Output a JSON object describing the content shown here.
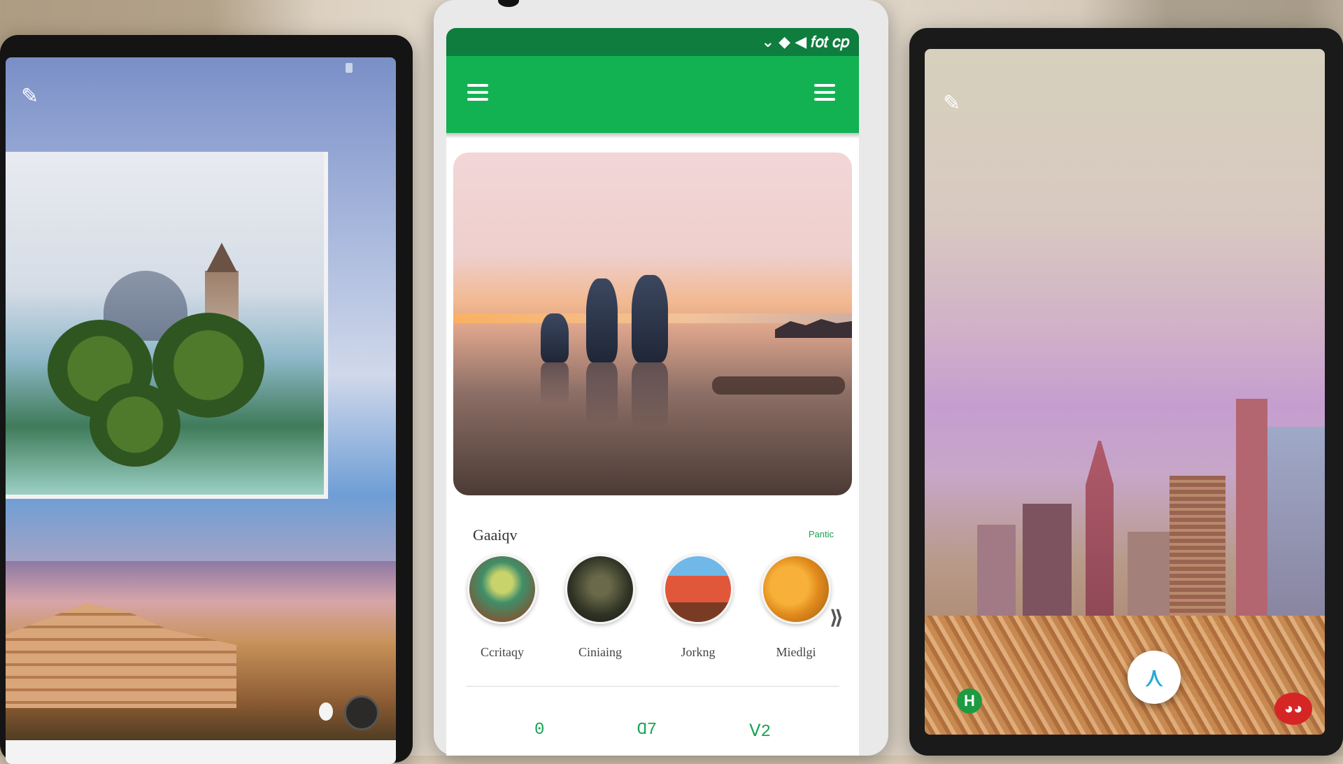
{
  "status_bar": {
    "text": "⌄ ◆ ◀ 𝑓𝑜𝑡 𝑐𝑝"
  },
  "gallery": {
    "title": "Gaaiqv",
    "link": "Pantic",
    "categories": [
      {
        "label": "Ccritaqy"
      },
      {
        "label": "Ciniaing"
      },
      {
        "label": "Jorkng"
      },
      {
        "label": "Miedlgi"
      }
    ],
    "more": "⟫"
  },
  "stats": [
    "0",
    "Ɑ7",
    "ꓦ2"
  ],
  "right_phone": {
    "h_badge": "H",
    "fab_icon": "⋏",
    "red_badge": "◕◕"
  },
  "colors": {
    "accent": "#12b252",
    "status": "#0e7d3e",
    "stat_text": "#19a454"
  }
}
